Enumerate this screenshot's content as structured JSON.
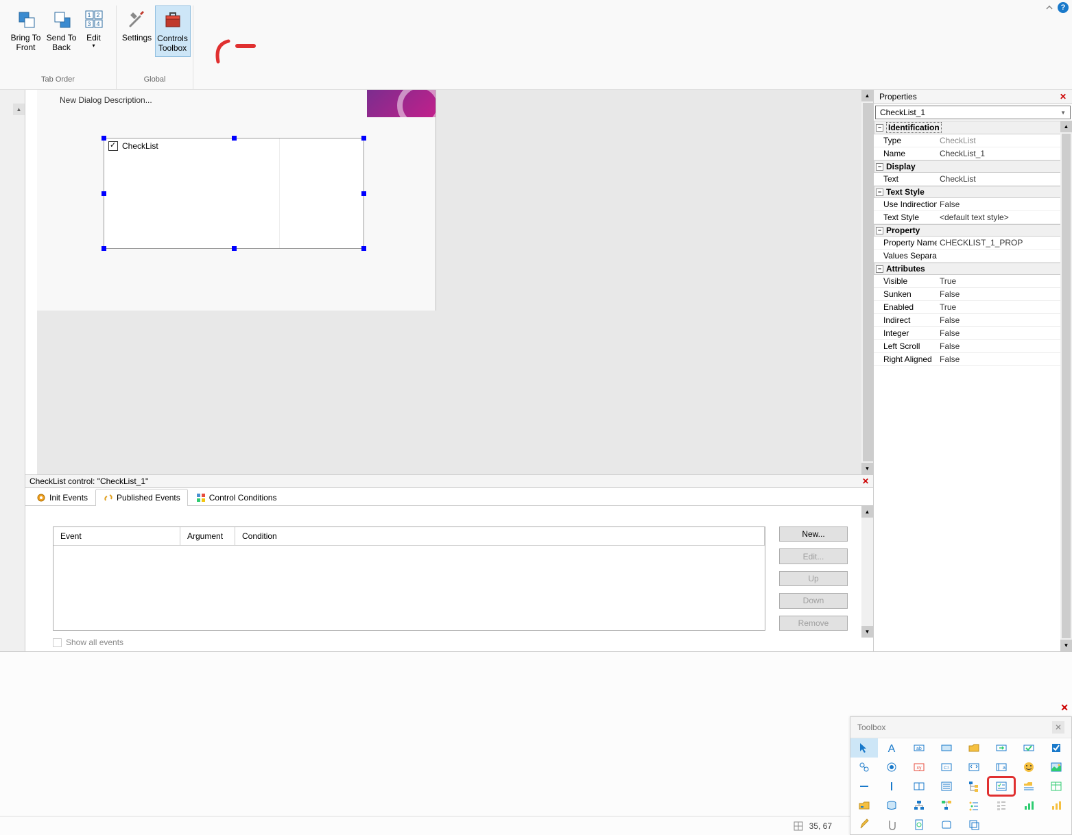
{
  "ribbon": {
    "tabOrder": {
      "label": "Tab Order",
      "bringToFront": "Bring To Front",
      "sendToBack": "Send To Back",
      "edit": "Edit"
    },
    "global": {
      "label": "Global",
      "settings": "Settings",
      "controlsToolbox": "Controls Toolbox"
    }
  },
  "form": {
    "description": "New Dialog Description...",
    "checklistLabel": "CheckList"
  },
  "eventsPane": {
    "title": "CheckList control: \"CheckList_1\"",
    "tabs": {
      "init": "Init Events",
      "published": "Published Events",
      "conditions": "Control Conditions"
    },
    "columns": {
      "event": "Event",
      "argument": "Argument",
      "condition": "Condition"
    },
    "buttons": {
      "new": "New...",
      "edit": "Edit...",
      "up": "Up",
      "down": "Down",
      "remove": "Remove"
    },
    "showAll": "Show all events"
  },
  "properties": {
    "title": "Properties",
    "selector": "CheckList_1",
    "groups": {
      "identification": "Identification",
      "display": "Display",
      "textStyle": "Text Style",
      "property": "Property",
      "attributes": "Attributes"
    },
    "rows": {
      "type_k": "Type",
      "type_v": "CheckList",
      "name_k": "Name",
      "name_v": "CheckList_1",
      "text_k": "Text",
      "text_v": "CheckList",
      "useind_k": "Use Indirection",
      "useind_v": "False",
      "tstyle_k": "Text Style",
      "tstyle_v": "<default text style>",
      "propname_k": "Property Name",
      "propname_v": "CHECKLIST_1_PROP",
      "valsep_k": "Values Separator",
      "valsep_v": "",
      "visible_k": "Visible",
      "visible_v": "True",
      "sunken_k": "Sunken",
      "sunken_v": "False",
      "enabled_k": "Enabled",
      "enabled_v": "True",
      "indirect_k": "Indirect",
      "indirect_v": "False",
      "integer_k": "Integer",
      "integer_v": "False",
      "leftscroll_k": "Left Scroll",
      "leftscroll_v": "False",
      "rightalign_k": "Right Aligned",
      "rightalign_v": "False"
    }
  },
  "status": {
    "coords": "35, 67"
  },
  "toolbox": {
    "title": "Toolbox"
  }
}
